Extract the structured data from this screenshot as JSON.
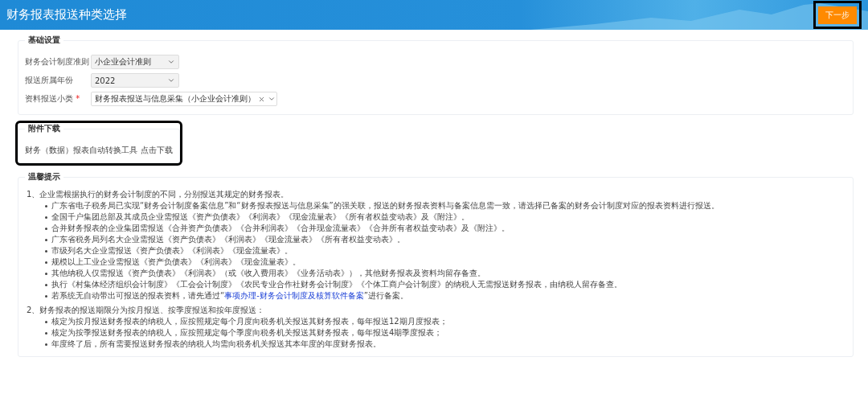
{
  "header": {
    "title": "财务报表报送种类选择",
    "next_button": {
      "label": "下一步",
      "highlighted": true
    }
  },
  "basic_settings": {
    "legend": "基础设置",
    "fields": [
      {
        "label": "财务会计制度准则",
        "value": "小企业会计准则",
        "required": false,
        "disabled": true,
        "kind": "select"
      },
      {
        "label": "报送所属年份",
        "value": "2022",
        "required": false,
        "disabled": true,
        "kind": "select"
      },
      {
        "label": "资料报送小类",
        "value": "财务报表报送与信息采集（小企业会计准则）",
        "required": true,
        "required_mark": "*",
        "disabled": false,
        "kind": "clearable"
      }
    ]
  },
  "attachments": {
    "legend": "附件下载",
    "highlighted": true,
    "tool_name": "财务（数据）报表自动转换工具",
    "link": "点击下载"
  },
  "tips": {
    "legend": "温馨提示",
    "items": [
      {
        "number": "1、",
        "text": "企业需根据执行的财务会计制度的不同，分别报送其规定的财务报表。",
        "children": [
          {
            "segments": [
              {
                "kind": "plain",
                "text": "广东省电子税务局已实现“财务会计制度备案信息”和“财务报表报送与信息采集”的强关联，报送的财务报表资料与备案信息需一致，请选择已备案的财务会计制度对应的报表资料进行报送。"
              }
            ]
          },
          {
            "segments": [
              {
                "kind": "plain",
                "text": "全国千户集团总部及其成员企业需报送《资产负债表》《利润表》《现金流量表》《所有者权益变动表》及《附注》。"
              }
            ]
          },
          {
            "segments": [
              {
                "kind": "plain",
                "text": "合并财务报表的企业集团需报送《合并资产负债表》《合并利润表》《合并现金流量表》《合并所有者权益变动表》及《附注》。"
              }
            ]
          },
          {
            "segments": [
              {
                "kind": "plain",
                "text": "广东省税务局列名大企业需报送《资产负债表》《利润表》《现金流量表》《所有者权益变动表》。"
              }
            ]
          },
          {
            "segments": [
              {
                "kind": "plain",
                "text": "市级列名大企业需报送《资产负债表》《利润表》《现金流量表》。"
              }
            ]
          },
          {
            "segments": [
              {
                "kind": "plain",
                "text": "规模以上工业企业需报送《资产负债表》《利润表》《现金流量表》。"
              }
            ]
          },
          {
            "segments": [
              {
                "kind": "plain",
                "text": "其他纳税人仅需报送《资产负债表》《利润表》（或《收入费用表》《业务活动表》），其他财务报表及资料均留存备查。"
              }
            ]
          },
          {
            "segments": [
              {
                "kind": "plain",
                "text": "执行《村集体经济组织会计制度》《工会会计制度》《农民专业合作社财务会计制度》《个体工商户会计制度》的纳税人无需报送财务报表，由纳税人留存备查。"
              }
            ]
          },
          {
            "segments": [
              {
                "kind": "plain",
                "text": "若系统无自动带出可报送的报表资料，请先通过“"
              },
              {
                "kind": "link",
                "text": "事项办理-财务会计制度及核算软件备案"
              },
              {
                "kind": "plain",
                "text": "”进行备案。"
              }
            ]
          }
        ]
      },
      {
        "number": "2、",
        "text": "财务报表的报送期限分为按月报送、按季度报送和按年度报送：",
        "children": [
          {
            "segments": [
              {
                "kind": "plain",
                "text": "核定为按月报送财务报表的纳税人，应按照规定每个月度向税务机关报送其财务报表，每年报送12期月度报表；"
              }
            ]
          },
          {
            "segments": [
              {
                "kind": "plain",
                "text": "核定为按季报送财务报表的纳税人，应按照规定每个季度向税务机关报送其财务报表，每年报送4期季度报表；"
              }
            ]
          },
          {
            "segments": [
              {
                "kind": "plain",
                "text": "年度终了后，所有需要报送财务报表的纳税人均需向税务机关报送其本年度的年度财务报表。"
              }
            ]
          }
        ]
      }
    ]
  }
}
